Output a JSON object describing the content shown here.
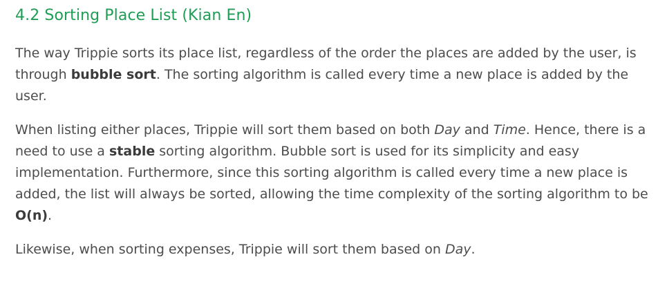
{
  "heading": "4.2 Sorting Place List (Kian En)",
  "p1": {
    "t1": "The way Trippie sorts its place list, regardless of the order the places are added by the user, is through ",
    "b1": "bubble sort",
    "t2": ". The sorting algorithm is called every time a new place is added by the user."
  },
  "p2": {
    "t1": "When listing either places, Trippie will sort them based on both ",
    "i1": "Day",
    "t2": " and ",
    "i2": "Time",
    "t3": ". Hence, there is a need to use a ",
    "b1": "stable",
    "t4": " sorting algorithm. Bubble sort is used for its simplicity and easy implementation. Furthermore, since this sorting algorithm is called every time a new place is added, the list will always be sorted, allowing the time complexity of the sorting algorithm to be ",
    "b2": "O(n)",
    "t5": "."
  },
  "p3": {
    "t1": "Likewise, when sorting expenses, Trippie will sort them based on ",
    "i1": "Day",
    "t2": "."
  }
}
